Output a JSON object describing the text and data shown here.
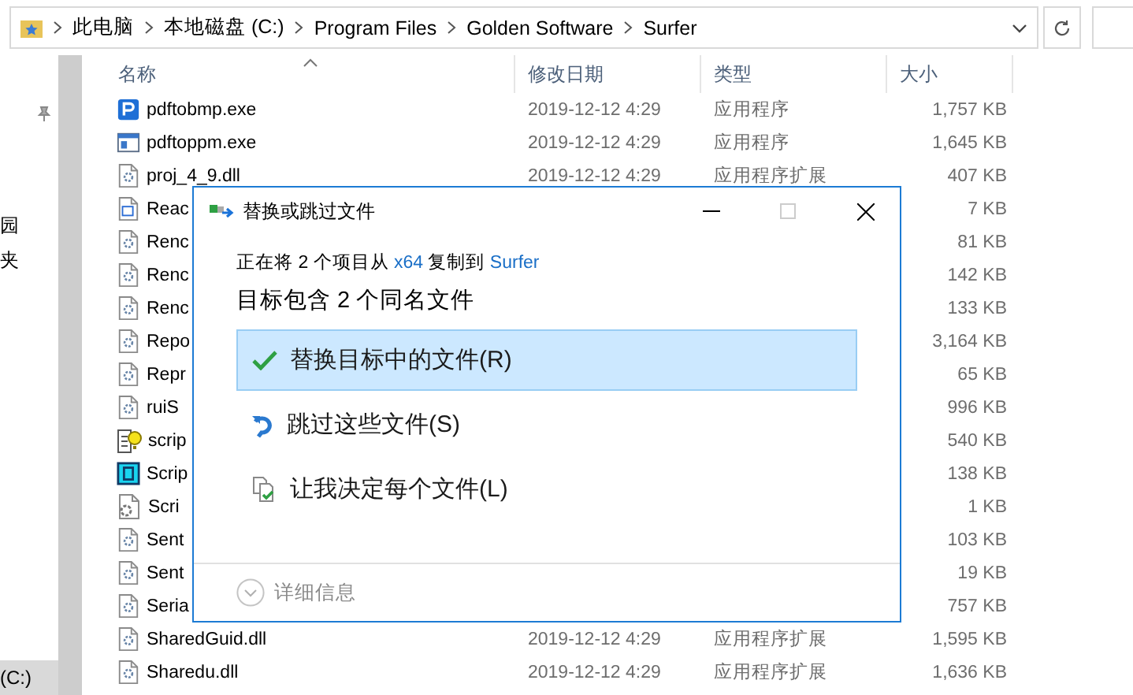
{
  "address_bar": {
    "crumbs": [
      "此电脑",
      "本地磁盘 (C:)",
      "Program Files",
      "Golden Software",
      "Surfer"
    ]
  },
  "nav_pane": {
    "items": [
      {
        "label": "园",
        "selected": false
      },
      {
        "label": "夹",
        "selected": false
      },
      {
        "label": "(C:)",
        "selected": true
      }
    ]
  },
  "file_list": {
    "columns": [
      "名称",
      "修改日期",
      "类型",
      "大小"
    ],
    "rows": [
      {
        "kind": "app-p",
        "name": "pdftobmp.exe",
        "date": "2019-12-12 4:29",
        "type": "应用程序",
        "size": "1,757 KB"
      },
      {
        "kind": "app",
        "name": "pdftoppm.exe",
        "date": "2019-12-12 4:29",
        "type": "应用程序",
        "size": "1,645 KB"
      },
      {
        "kind": "dll",
        "name": "proj_4_9.dll",
        "date": "2019-12-12 4:29",
        "type": "应用程序扩展",
        "size": "407 KB"
      },
      {
        "kind": "doc",
        "name": "Reac",
        "size": "7 KB"
      },
      {
        "kind": "dll",
        "name": "Renc",
        "size": "81 KB"
      },
      {
        "kind": "dll",
        "name": "Renc",
        "size": "142 KB"
      },
      {
        "kind": "dll",
        "name": "Renc",
        "size": "133 KB"
      },
      {
        "kind": "dll",
        "name": "Repo",
        "size": "3,164 KB"
      },
      {
        "kind": "dll",
        "name": "Repr",
        "size": "65 KB"
      },
      {
        "kind": "dll",
        "name": "ruiS",
        "size": "996 KB"
      },
      {
        "kind": "help",
        "name": "scrip",
        "size": "540 KB"
      },
      {
        "kind": "script",
        "name": "Scrip",
        "size": "138 KB"
      },
      {
        "kind": "config",
        "name": "Scri",
        "size": "1 KB"
      },
      {
        "kind": "dll",
        "name": "Sent",
        "size": "103 KB"
      },
      {
        "kind": "dll",
        "name": "Sent",
        "size": "19 KB"
      },
      {
        "kind": "dll",
        "name": "Seria",
        "size": "757 KB"
      },
      {
        "kind": "dll",
        "name": "SharedGuid.dll",
        "date": "2019-12-12 4:29",
        "type": "应用程序扩展",
        "size": "1,595 KB"
      },
      {
        "kind": "dll",
        "name": "Sharedu.dll",
        "date": "2019-12-12 4:29",
        "type": "应用程序扩展",
        "size": "1,636 KB"
      }
    ]
  },
  "dialog": {
    "title": "替换或跳过文件",
    "status": [
      {
        "kind": "text",
        "text": "正在将 2 个项目从 "
      },
      {
        "kind": "link",
        "text": "x64"
      },
      {
        "kind": "text",
        "text": " 复制到 "
      },
      {
        "kind": "link",
        "text": "Surfer"
      }
    ],
    "heading": "目标包含 2 个同名文件",
    "options": [
      {
        "kind": "replace",
        "label": "替换目标中的文件(R)",
        "selected": true
      },
      {
        "kind": "skip",
        "label": "跳过这些文件(S)",
        "selected": false
      },
      {
        "kind": "decide",
        "label": "让我决定每个文件(L)",
        "selected": false
      }
    ],
    "details": "详细信息"
  }
}
